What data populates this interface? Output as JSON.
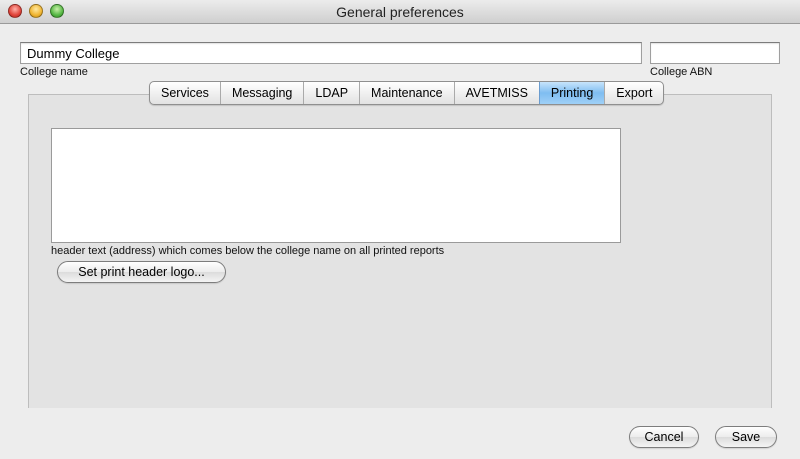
{
  "window": {
    "title": "General preferences",
    "controls": [
      "close-icon",
      "minimize-icon",
      "zoom-icon"
    ]
  },
  "college": {
    "name_value": "Dummy College",
    "name_label": "College name",
    "abn_value": "",
    "abn_label": "College ABN"
  },
  "tabs": [
    {
      "label": "Services",
      "active": false
    },
    {
      "label": "Messaging",
      "active": false
    },
    {
      "label": "LDAP",
      "active": false
    },
    {
      "label": "Maintenance",
      "active": false
    },
    {
      "label": "AVETMISS",
      "active": false
    },
    {
      "label": "Printing",
      "active": true
    },
    {
      "label": "Export",
      "active": false
    }
  ],
  "printing": {
    "header_text_value": "",
    "header_text_label": "header text (address) which comes below the college name on all printed reports",
    "logo_button": "Set print header logo..."
  },
  "footer": {
    "cancel": "Cancel",
    "save": "Save"
  },
  "colors": {
    "active_tab": "#7fbdf1",
    "close_light": "#e0443a",
    "minimize_light": "#f0b532",
    "zoom_light": "#57b845"
  }
}
